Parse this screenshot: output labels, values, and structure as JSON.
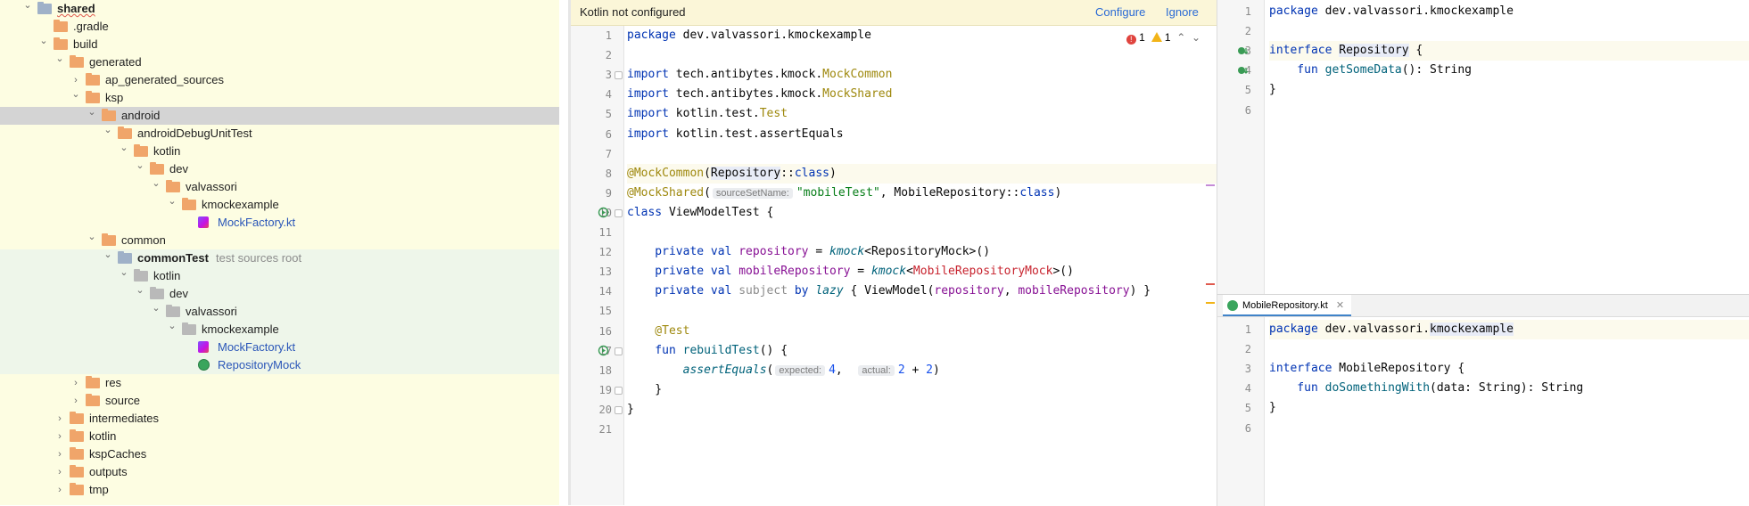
{
  "colors": {
    "selected_row": "#d4d4d4",
    "yellow_tree": "#fdfde2",
    "green_tree": "#eef6ea",
    "link": "#2a6ad5"
  },
  "tree": {
    "items": [
      {
        "label": "shared",
        "depth": 0,
        "expanded": true,
        "icon": "module-folder-icon",
        "bold": true,
        "bg": "yellow"
      },
      {
        "label": ".gradle",
        "depth": 1,
        "expanded": null,
        "icon": "orange-folder-icon",
        "bg": "yellow"
      },
      {
        "label": "build",
        "depth": 1,
        "expanded": true,
        "icon": "orange-folder-icon",
        "bg": "yellow"
      },
      {
        "label": "generated",
        "depth": 2,
        "expanded": true,
        "icon": "orange-folder-icon",
        "bg": "yellow"
      },
      {
        "label": "ap_generated_sources",
        "depth": 3,
        "expanded": false,
        "icon": "orange-folder-icon",
        "bg": "yellow"
      },
      {
        "label": "ksp",
        "depth": 3,
        "expanded": true,
        "icon": "orange-folder-icon",
        "bg": "yellow"
      },
      {
        "label": "android",
        "depth": 4,
        "expanded": true,
        "icon": "orange-folder-icon",
        "bg": "selected"
      },
      {
        "label": "androidDebugUnitTest",
        "depth": 5,
        "expanded": true,
        "icon": "orange-folder-icon",
        "bg": "yellow"
      },
      {
        "label": "kotlin",
        "depth": 6,
        "expanded": true,
        "icon": "orange-folder-icon",
        "bg": "yellow"
      },
      {
        "label": "dev",
        "depth": 7,
        "expanded": true,
        "icon": "orange-folder-icon",
        "bg": "yellow"
      },
      {
        "label": "valvassori",
        "depth": 8,
        "expanded": true,
        "icon": "orange-folder-icon",
        "bg": "yellow"
      },
      {
        "label": "kmockexample",
        "depth": 9,
        "expanded": true,
        "icon": "orange-folder-icon",
        "bg": "yellow"
      },
      {
        "label": "MockFactory.kt",
        "depth": 10,
        "expanded": null,
        "icon": "kotlin-file-icon",
        "bg": "yellow",
        "link": true
      },
      {
        "label": "common",
        "depth": 4,
        "expanded": true,
        "icon": "orange-folder-icon",
        "bg": "yellow"
      },
      {
        "label": "commonTest",
        "depth": 5,
        "expanded": true,
        "icon": "test-module-icon",
        "bg": "green",
        "bold": true,
        "suffix": "test sources root"
      },
      {
        "label": "kotlin",
        "depth": 6,
        "expanded": true,
        "icon": "grey-folder-icon",
        "bg": "green"
      },
      {
        "label": "dev",
        "depth": 7,
        "expanded": true,
        "icon": "grey-folder-icon",
        "bg": "green"
      },
      {
        "label": "valvassori",
        "depth": 8,
        "expanded": true,
        "icon": "grey-folder-icon",
        "bg": "green"
      },
      {
        "label": "kmockexample",
        "depth": 9,
        "expanded": true,
        "icon": "grey-folder-icon",
        "bg": "green"
      },
      {
        "label": "MockFactory.kt",
        "depth": 10,
        "expanded": null,
        "icon": "kotlin-file-icon",
        "bg": "green",
        "link": true
      },
      {
        "label": "RepositoryMock",
        "depth": 10,
        "expanded": null,
        "icon": "kotlin-class-icon",
        "bg": "green",
        "link": true
      },
      {
        "label": "res",
        "depth": 3,
        "expanded": false,
        "icon": "orange-folder-icon",
        "bg": "yellow"
      },
      {
        "label": "source",
        "depth": 3,
        "expanded": false,
        "icon": "orange-folder-icon",
        "bg": "yellow"
      },
      {
        "label": "intermediates",
        "depth": 2,
        "expanded": false,
        "icon": "orange-folder-icon",
        "bg": "yellow"
      },
      {
        "label": "kotlin",
        "depth": 2,
        "expanded": false,
        "icon": "orange-folder-icon",
        "bg": "yellow"
      },
      {
        "label": "kspCaches",
        "depth": 2,
        "expanded": false,
        "icon": "orange-folder-icon",
        "bg": "yellow"
      },
      {
        "label": "outputs",
        "depth": 2,
        "expanded": false,
        "icon": "orange-folder-icon",
        "bg": "yellow"
      },
      {
        "label": "tmp",
        "depth": 2,
        "expanded": false,
        "icon": "orange-folder-icon",
        "bg": "yellow"
      }
    ]
  },
  "banner": {
    "message": "Kotlin not configured",
    "configure": "Configure",
    "ignore": "Ignore"
  },
  "inspections": {
    "errors": "1",
    "warnings": "1"
  },
  "main_editor": {
    "lines": [
      [
        {
          "t": "package ",
          "c": "kw"
        },
        {
          "t": "dev.valvassori.kmockexample"
        }
      ],
      [],
      [
        {
          "t": "import ",
          "c": "kw"
        },
        {
          "t": "tech.antibytes.kmock."
        },
        {
          "t": "MockCommon",
          "c": "ann"
        }
      ],
      [
        {
          "t": "import ",
          "c": "kw"
        },
        {
          "t": "tech.antibytes.kmock."
        },
        {
          "t": "MockShared",
          "c": "ann"
        }
      ],
      [
        {
          "t": "import ",
          "c": "kw"
        },
        {
          "t": "kotlin.test."
        },
        {
          "t": "Test",
          "c": "ann"
        }
      ],
      [
        {
          "t": "import ",
          "c": "kw"
        },
        {
          "t": "kotlin.test.assertEquals"
        }
      ],
      [],
      [
        {
          "t": "@MockCommon",
          "c": "ann"
        },
        {
          "t": "("
        },
        {
          "t": "Repository",
          "c": "ref"
        },
        {
          "t": "::"
        },
        {
          "t": "class",
          "c": "kw"
        },
        {
          "t": ")"
        }
      ],
      [
        {
          "t": "@MockShared",
          "c": "ann"
        },
        {
          "t": "("
        },
        {
          "t": "sourceSetName:",
          "c": "hint"
        },
        {
          "t": "\"mobileTest\"",
          "c": "str"
        },
        {
          "t": ", MobileRepository::"
        },
        {
          "t": "class",
          "c": "kw"
        },
        {
          "t": ")"
        }
      ],
      [
        {
          "t": "class ",
          "c": "kw"
        },
        {
          "t": "ViewModelTest {"
        }
      ],
      [],
      [
        {
          "t": "    private val ",
          "c": "kw"
        },
        {
          "t": "repository",
          "c": "prop"
        },
        {
          "t": " = "
        },
        {
          "t": "kmock",
          "c": "italicfn"
        },
        {
          "t": "<RepositoryMock>()"
        }
      ],
      [
        {
          "t": "    private val ",
          "c": "kw"
        },
        {
          "t": "mobileRepository",
          "c": "prop"
        },
        {
          "t": " = "
        },
        {
          "t": "kmock",
          "c": "italicfn"
        },
        {
          "t": "<"
        },
        {
          "t": "MobileRepositoryMock",
          "c": "err"
        },
        {
          "t": ">()"
        }
      ],
      [
        {
          "t": "    private val ",
          "c": "kw"
        },
        {
          "t": "subject",
          "c": "dimmed"
        },
        {
          "t": " by ",
          "c": "kw"
        },
        {
          "t": "lazy",
          "c": "italicfn"
        },
        {
          "t": " { ViewModel("
        },
        {
          "t": "repository",
          "c": "prop"
        },
        {
          "t": ", "
        },
        {
          "t": "mobileRepository",
          "c": "prop"
        },
        {
          "t": ") }"
        }
      ],
      [],
      [
        {
          "t": "    @Test",
          "c": "ann"
        }
      ],
      [
        {
          "t": "    fun ",
          "c": "kw"
        },
        {
          "t": "rebuildTest",
          "c": "fn"
        },
        {
          "t": "() {"
        }
      ],
      [
        {
          "t": "        "
        },
        {
          "t": "assertEquals",
          "c": "italicfn"
        },
        {
          "t": "("
        },
        {
          "t": "expected:",
          "c": "hint"
        },
        {
          "t": "4",
          "c": "num"
        },
        {
          "t": ",  "
        },
        {
          "t": "actual:",
          "c": "hint"
        },
        {
          "t": "2",
          "c": "num"
        },
        {
          "t": " + "
        },
        {
          "t": "2",
          "c": "num"
        },
        {
          "t": ")"
        }
      ],
      [
        {
          "t": "    }"
        }
      ],
      [
        {
          "t": "}"
        }
      ],
      []
    ]
  },
  "top_editor": {
    "lines": [
      [
        {
          "t": "package ",
          "c": "kw"
        },
        {
          "t": "dev.valvassori.kmockexample"
        }
      ],
      [],
      [
        {
          "t": "interface ",
          "c": "kw"
        },
        {
          "t": "Repository",
          "c": "ref"
        },
        {
          "t": " {"
        }
      ],
      [
        {
          "t": "    fun ",
          "c": "kw"
        },
        {
          "t": "getSomeData",
          "c": "fn"
        },
        {
          "t": "(): String"
        }
      ],
      [
        {
          "t": "}"
        }
      ],
      []
    ]
  },
  "bottom_editor": {
    "tab_label": "MobileRepository.kt",
    "lines": [
      [
        {
          "t": "package ",
          "c": "kw"
        },
        {
          "t": "dev.valvassori."
        },
        {
          "t": "kmockexample",
          "c": "ref"
        }
      ],
      [],
      [
        {
          "t": "interface ",
          "c": "kw"
        },
        {
          "t": "MobileRepository {"
        }
      ],
      [
        {
          "t": "    fun ",
          "c": "kw"
        },
        {
          "t": "doSomethingWith",
          "c": "fn"
        },
        {
          "t": "(data: String): String"
        }
      ],
      [
        {
          "t": "}"
        }
      ],
      []
    ]
  }
}
